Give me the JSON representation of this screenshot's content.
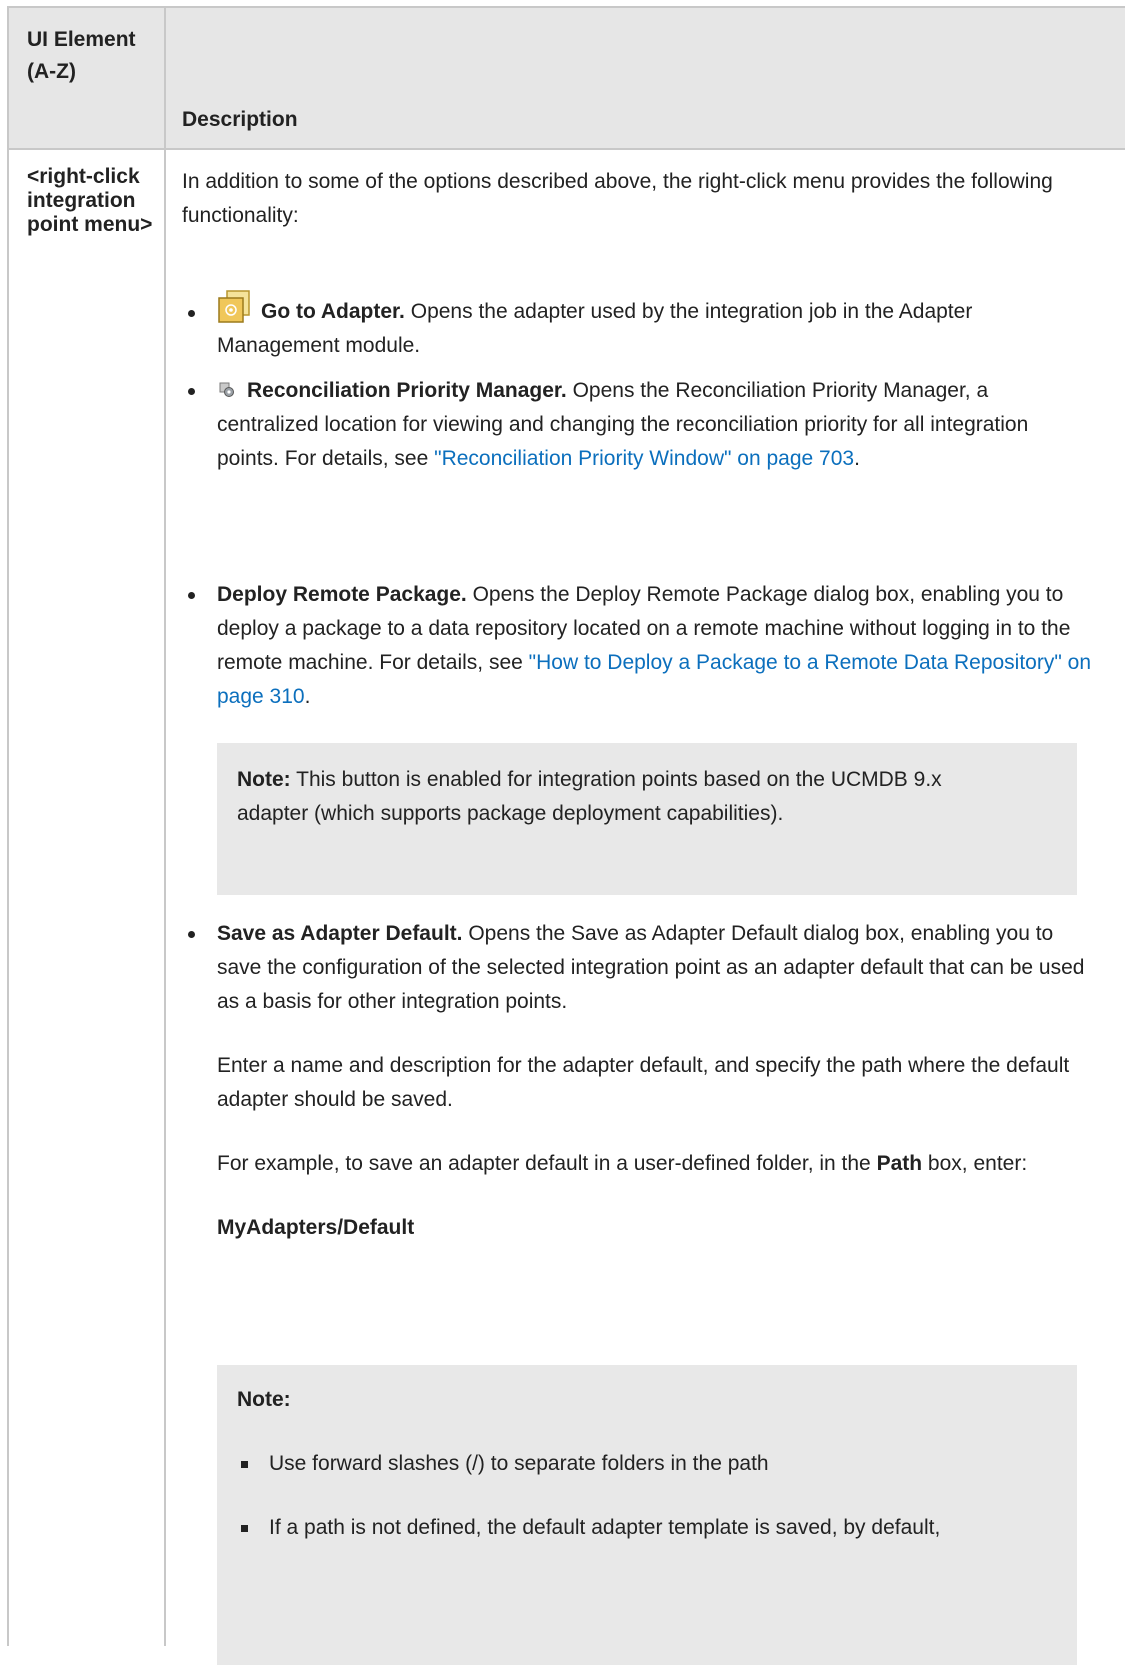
{
  "header": {
    "col1": "UI Element (A-Z)",
    "col2": "Description"
  },
  "row": {
    "element": "<right-click integration point menu>",
    "intro": "In addition to some of the options described above, the right-click menu provides the following functionality:",
    "items": [
      {
        "icon": "go-to-adapter-icon",
        "title": "Go to Adapter.",
        "text": " Opens the adapter used by the integration job in the Adapter Management module."
      },
      {
        "icon": "reconciliation-priority-icon",
        "title": "Reconciliation Priority Manager.",
        "text": " Opens the Reconciliation Priority Manager, a centralized location for viewing and changing the reconciliation priority for all integration points. For details, see ",
        "link": "\"Reconciliation Priority Window\" on page 703",
        "after": "."
      },
      {
        "title": "Deploy Remote Package.",
        "text": " Opens the Deploy Remote Package dialog box, enabling you to deploy a package to a data repository located on a remote machine without logging in to the remote machine. For details, see ",
        "link": "\"How to Deploy a Package to a Remote Data Repository\" on page 310",
        "after": ".",
        "note_label": "Note:",
        "note_text": " This button is enabled for integration points based on the UCMDB 9.x adapter (which supports package deployment capabilities)."
      },
      {
        "title": "Save as Adapter Default.",
        "text": " Opens the Save as Adapter Default dialog box, enabling you to save the configuration of the selected integration point as an adapter default that can be used as a basis for other integration points.",
        "para2": "Enter a name and description for the adapter default, and specify the path where the default adapter should be saved.",
        "para3_pre": "For example, to save an adapter default in a user-defined folder, in the ",
        "para3_bold": "Path",
        "para3_post": " box, enter:",
        "path_example": "MyAdapters/Default",
        "note_label": "Note:",
        "note_bullets": [
          "Use forward slashes (/) to separate folders in the path",
          "If a path is not defined, the default adapter template is saved, by default,"
        ]
      }
    ]
  }
}
